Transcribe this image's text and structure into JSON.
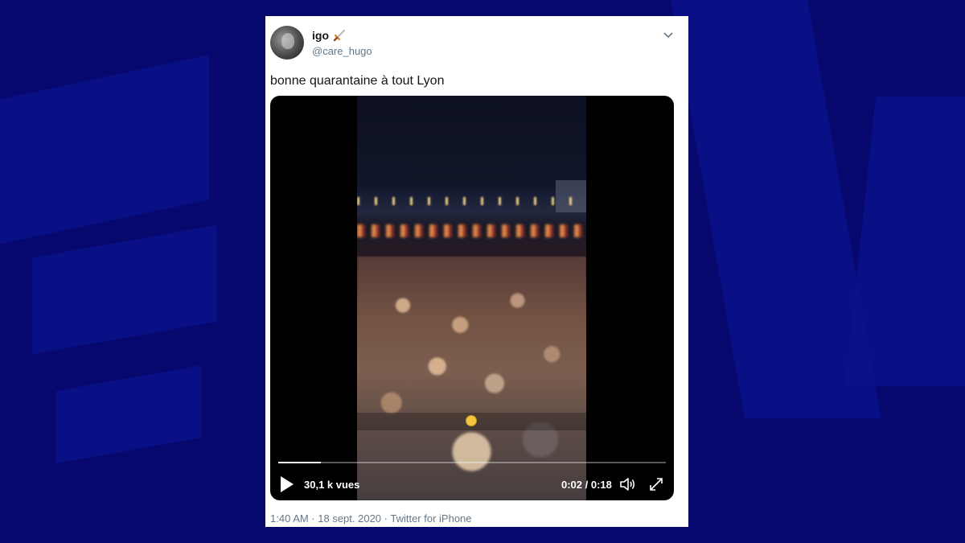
{
  "tweet": {
    "user_name": "igo",
    "name_emoji": "dagger",
    "handle": "@care_hugo",
    "text": "bonne quarantaine à tout Lyon",
    "meta": "1:40 AM · 18 sept. 2020 · Twitter for iPhone"
  },
  "video": {
    "views": "30,1 k vues",
    "time": "0:02 / 0:18",
    "progress": 0.11,
    "icons": [
      "play-icon",
      "volume-icon",
      "fullscreen-icon"
    ]
  },
  "colors": {
    "background": "#06086e",
    "card": "#ffffff",
    "text_primary": "#14171a",
    "text_secondary": "#657786"
  }
}
